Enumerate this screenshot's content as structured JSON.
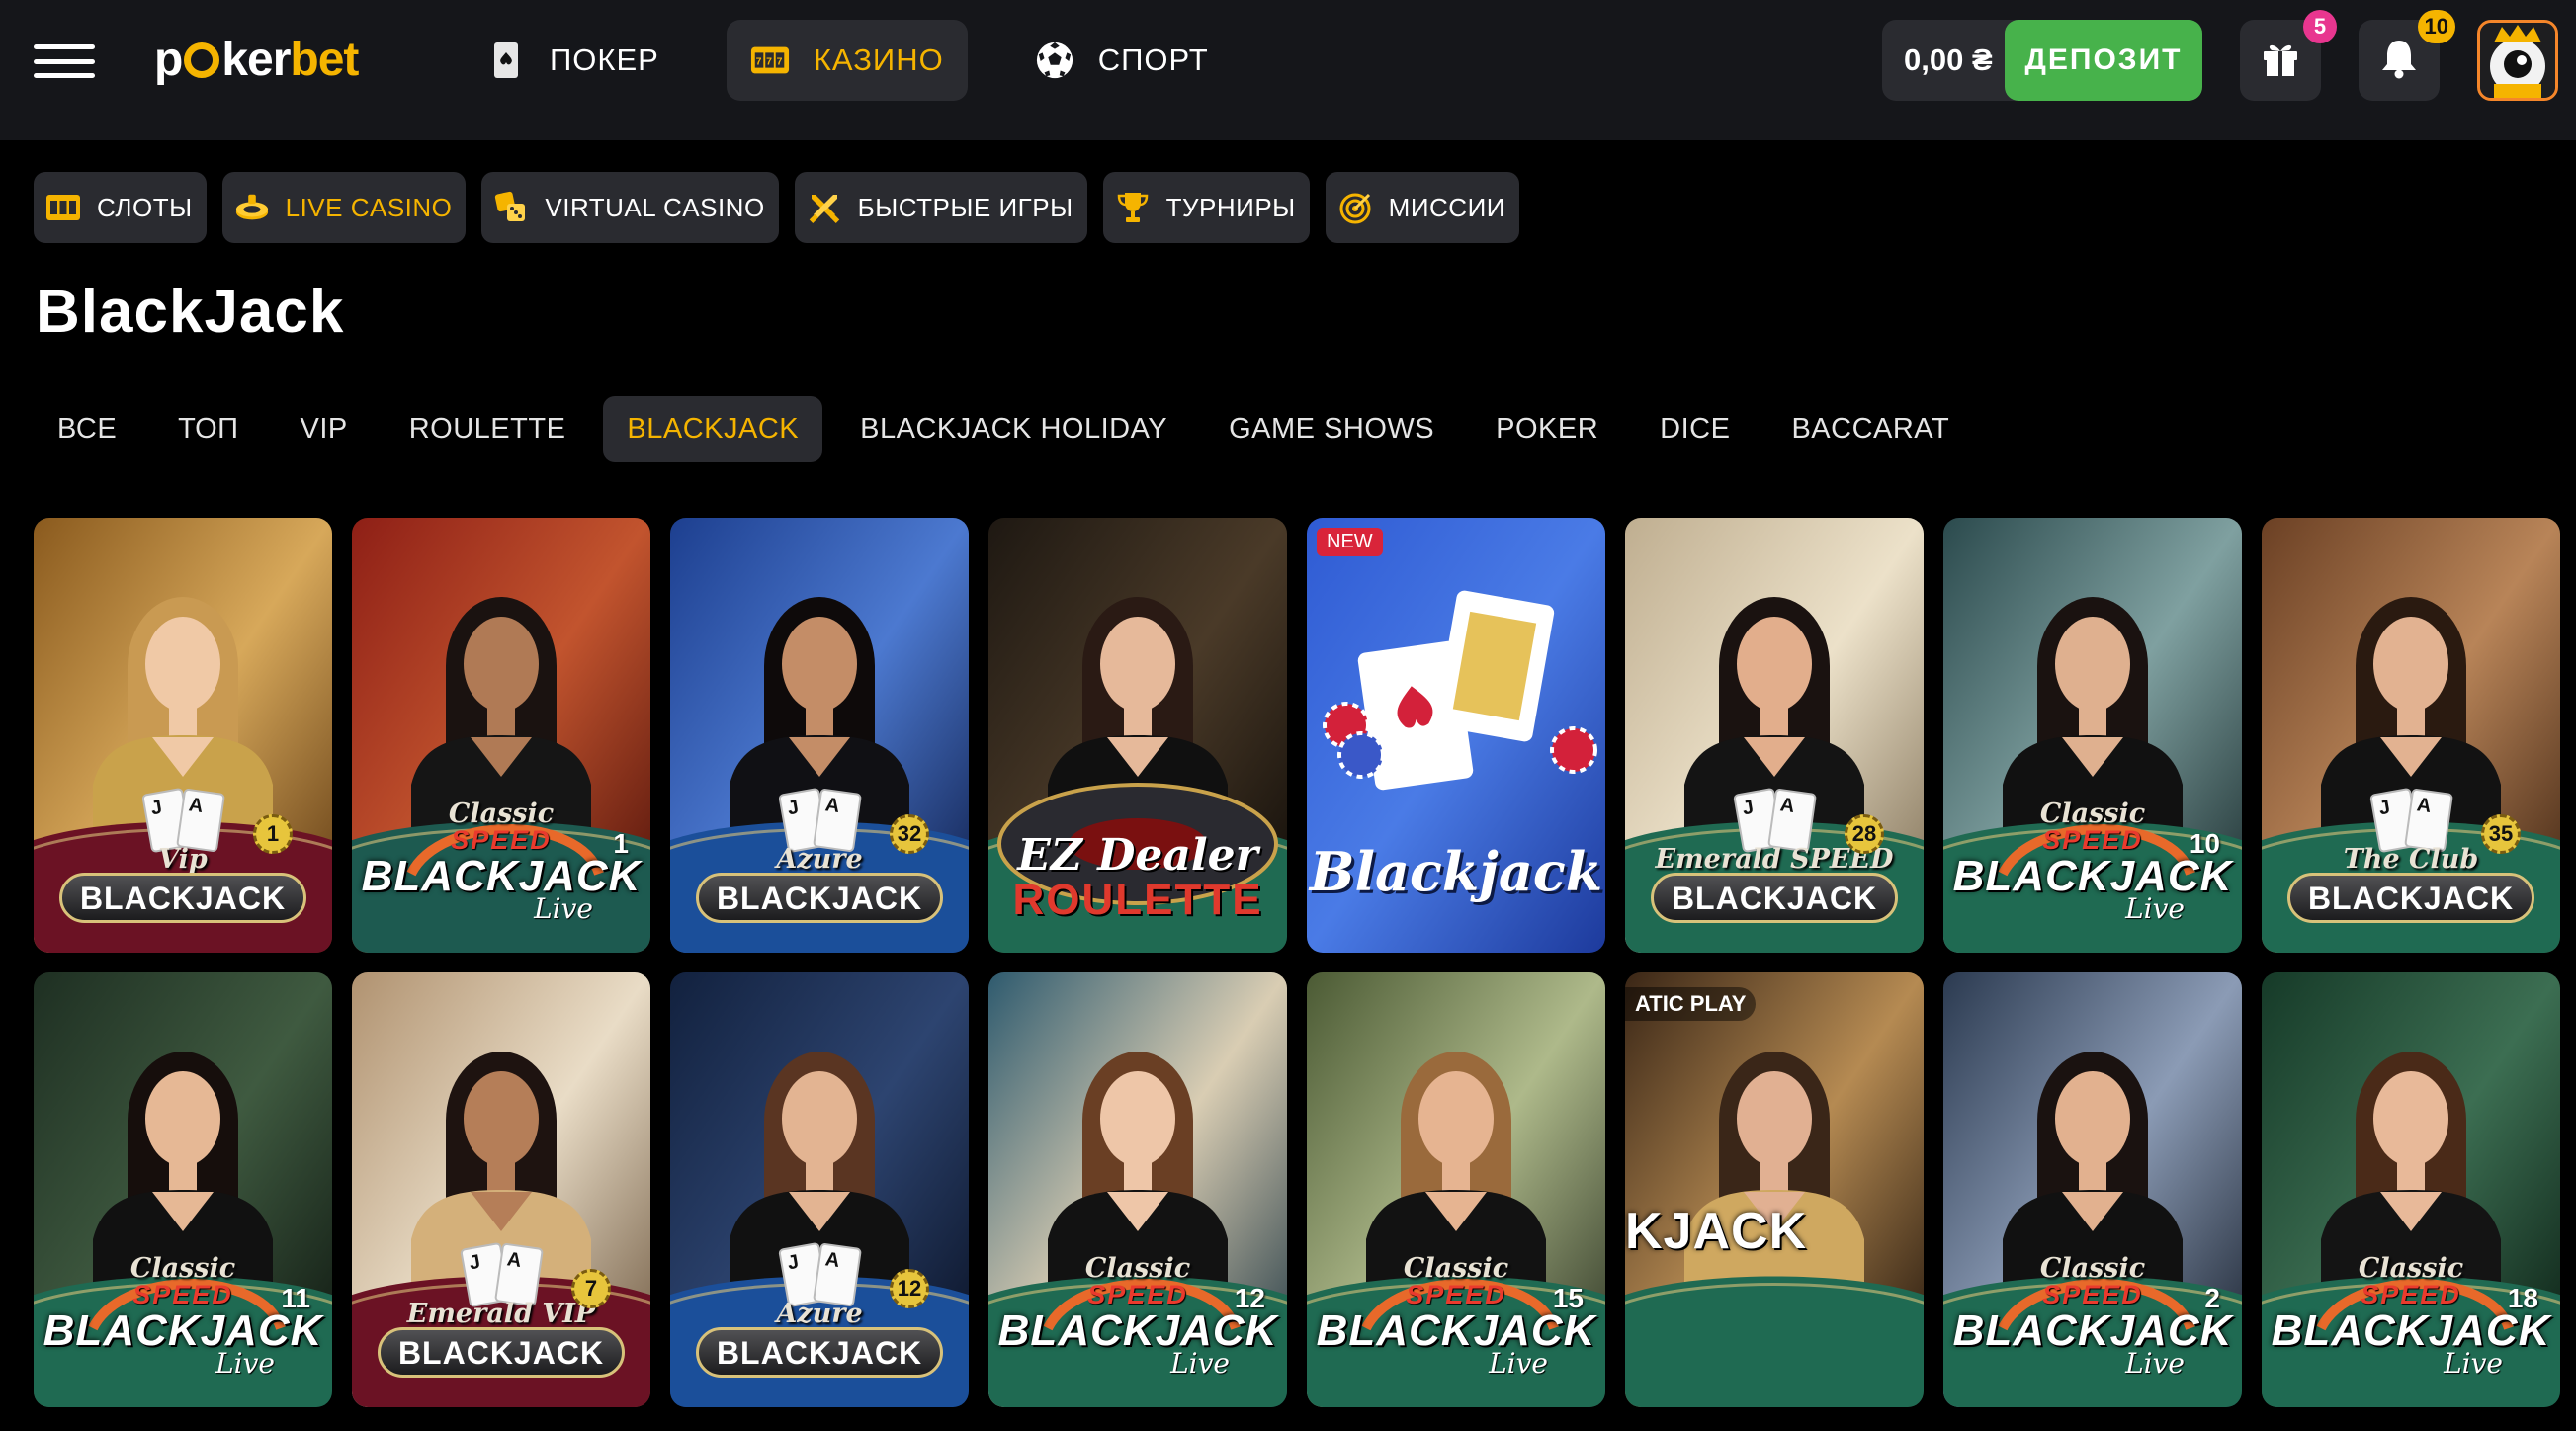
{
  "header": {
    "logo_pre": "p",
    "logo_mid": "ker",
    "logo_bet": "bet",
    "nav": [
      {
        "label": "ПОКЕР",
        "icon": "poker-card-icon",
        "active": false
      },
      {
        "label": "КАЗИНО",
        "icon": "slot-machine-icon",
        "active": true
      },
      {
        "label": "СПОРТ",
        "icon": "soccer-ball-icon",
        "active": false
      }
    ],
    "balance": "0,00 ₴",
    "deposit_label": "ДЕПОЗИТ",
    "gift_count": "5",
    "notification_count": "10"
  },
  "categories": [
    {
      "label": "СЛОТЫ",
      "icon": "slots-icon",
      "active": false
    },
    {
      "label": "LIVE CASINO",
      "icon": "live-casino-icon",
      "active": true
    },
    {
      "label": "VIRTUAL CASINO",
      "icon": "dice-icon",
      "active": false
    },
    {
      "label": "БЫСТРЫЕ ИГРЫ",
      "icon": "crossed-swords-icon",
      "active": false
    },
    {
      "label": "ТУРНИРЫ",
      "icon": "trophy-icon",
      "active": false
    },
    {
      "label": "МИССИИ",
      "icon": "target-icon",
      "active": false
    }
  ],
  "page_title": "BlackJack",
  "subtabs": [
    {
      "label": "ВСЕ",
      "active": false
    },
    {
      "label": "ТОП",
      "active": false
    },
    {
      "label": "VIP",
      "active": false
    },
    {
      "label": "ROULETTE",
      "active": false
    },
    {
      "label": "BLACKJACK",
      "active": true
    },
    {
      "label": "BLACKJACK HOLIDAY",
      "active": false
    },
    {
      "label": "GAME SHOWS",
      "active": false
    },
    {
      "label": "POKER",
      "active": false
    },
    {
      "label": "DICE",
      "active": false
    },
    {
      "label": "BACCARAT",
      "active": false
    }
  ],
  "games": [
    {
      "style": "pill",
      "sub": "Vip",
      "main": "BLACKJACK",
      "num": "1",
      "bg": "gold",
      "skin": "#f0c9a6",
      "hair": "#c99a52",
      "top": "#c9a24b"
    },
    {
      "style": "speed",
      "sub": "Classic",
      "speed": "SPEED",
      "main": "BLACKJACK",
      "live": "Live",
      "num": "1",
      "bg": "red",
      "skin": "#b07a55",
      "hair": "#1a1210",
      "top": "#151515"
    },
    {
      "style": "pill",
      "sub": "Azure",
      "main": "BLACKJACK",
      "num": "32",
      "bg": "blue",
      "skin": "#c48d67",
      "hair": "#0e0a0a",
      "top": "#101014"
    },
    {
      "style": "ez",
      "sub": "EZ Dealer",
      "main": "ROULETTE",
      "bg": "dark",
      "skin": "#e6b99a",
      "hair": "#2a1a14",
      "top": "#101010"
    },
    {
      "style": "script",
      "main": "Blackjack",
      "new": "NEW",
      "bg": "bluegame"
    },
    {
      "style": "pill",
      "sub": "Emerald SPEED",
      "main": "BLACKJACK",
      "num": "28",
      "bg": "cream",
      "skin": "#e2ae8c",
      "hair": "#1a1210",
      "top": "#141414"
    },
    {
      "style": "speed",
      "sub": "Classic",
      "speed": "SPEED",
      "main": "BLACKJACK",
      "live": "Live",
      "num": "10",
      "bg": "teal",
      "skin": "#dfb08f",
      "hair": "#1a1210",
      "top": "#111111"
    },
    {
      "style": "pill",
      "sub": "The Club",
      "main": "BLACKJACK",
      "num": "35",
      "bg": "wood",
      "skin": "#e2b291",
      "hair": "#2a1a10",
      "top": "#121212"
    },
    {
      "style": "speed",
      "sub": "Classic",
      "speed": "SPEED",
      "main": "BLACKJACK",
      "live": "Live",
      "num": "11",
      "bg": "plant",
      "skin": "#e6b895",
      "hair": "#160e0c",
      "top": "#111111"
    },
    {
      "style": "pill",
      "sub": "Emerald VIP",
      "main": "BLACKJACK",
      "num": "7",
      "bg": "beige",
      "skin": "#b57e58",
      "hair": "#1e1310",
      "top": "#d4b07a"
    },
    {
      "style": "pill",
      "sub": "Azure",
      "main": "BLACKJACK",
      "num": "12",
      "bg": "navy",
      "skin": "#e3b492",
      "hair": "#5a3522",
      "top": "#111111"
    },
    {
      "style": "speed",
      "sub": "Classic",
      "speed": "SPEED",
      "main": "BLACKJACK",
      "live": "Live",
      "num": "12",
      "bg": "arch",
      "skin": "#eec6a8",
      "hair": "#6a3f24",
      "top": "#121212"
    },
    {
      "style": "speed",
      "sub": "Classic",
      "speed": "SPEED",
      "main": "BLACKJACK",
      "live": "Live",
      "num": "15",
      "bg": "bamboo",
      "skin": "#e6b491",
      "hair": "#9a6a3c",
      "top": "#121212"
    },
    {
      "style": "pragmatic",
      "sub": "ATIC PLAY",
      "main": "KJACK",
      "bg": "pragmatic",
      "skin": "#e1b092",
      "hair": "#3a2618",
      "top": "#cfa860"
    },
    {
      "style": "speed",
      "sub": "Classic",
      "speed": "SPEED",
      "main": "BLACKJACK",
      "live": "Live",
      "num": "2",
      "bg": "city",
      "skin": "#e2b18f",
      "hair": "#1a1210",
      "top": "#111111"
    },
    {
      "style": "speed",
      "sub": "Classic",
      "speed": "SPEED",
      "main": "BLACKJACK",
      "live": "Live",
      "num": "18",
      "bg": "green",
      "skin": "#e8b999",
      "hair": "#4a2a18",
      "top": "#141414"
    }
  ],
  "colors": {
    "accent": "#f5b400",
    "deposit": "#47b24b",
    "header_bg": "#15161a",
    "chip_bg": "#2a2b30",
    "badge_pink": "#e8368f"
  }
}
